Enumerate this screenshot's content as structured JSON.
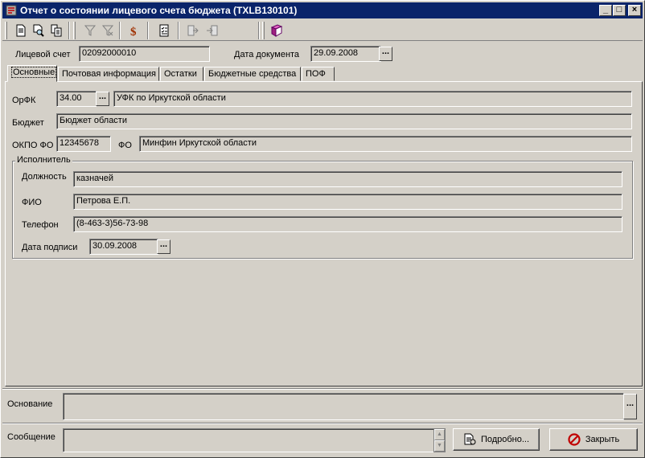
{
  "window": {
    "title": "Отчет о состоянии лицевого счета бюджета (TXLB130101)",
    "controls": {
      "minimize": "_",
      "maximize": "□",
      "close": "×"
    }
  },
  "toolbar": {
    "icons": [
      "new-doc-icon",
      "preview-icon",
      "copy-doc-icon",
      "filter-icon",
      "filter-off-icon",
      "currency-icon",
      "checklist-icon",
      "export-icon",
      "import-icon",
      "book-icon"
    ]
  },
  "header": {
    "account_label": "Лицевой счет",
    "account_value": "02092000010",
    "doc_date_label": "Дата документа",
    "doc_date_value": "29.09.2008"
  },
  "tabs": [
    {
      "label": "Основные",
      "active": true
    },
    {
      "label": "Почтовая информация"
    },
    {
      "label": "Остатки"
    },
    {
      "label": "Бюджетные средства"
    },
    {
      "label": "ПОФ"
    }
  ],
  "main": {
    "orfk_label": "ОрФК",
    "orfk_code": "34.00",
    "orfk_name": "УФК по Иркутской области",
    "budget_label": "Бюджет",
    "budget_value": "Бюджет области",
    "okpo_label": "ОКПО ФО",
    "okpo_value": "12345678",
    "fo_label": "ФО",
    "fo_value": "Минфин Иркутской области",
    "executor": {
      "title": "Исполнитель",
      "position_label": "Должность",
      "position_value": "казначей",
      "fio_label": "ФИО",
      "fio_value": "Петрова Е.П.",
      "phone_label": "Телефон",
      "phone_value": "(8-463-3)56-73-98",
      "sign_date_label": "Дата подписи",
      "sign_date_value": "30.09.2008"
    }
  },
  "footer": {
    "basis_label": "Основание",
    "basis_value": "",
    "message_label": "Сообщение",
    "message_value": "",
    "details_button": "Подробно...",
    "close_button": "Закрыть"
  },
  "colors": {
    "titlebar": "#0a246a",
    "face": "#d4d0c8",
    "close_icon": "#c00000"
  }
}
